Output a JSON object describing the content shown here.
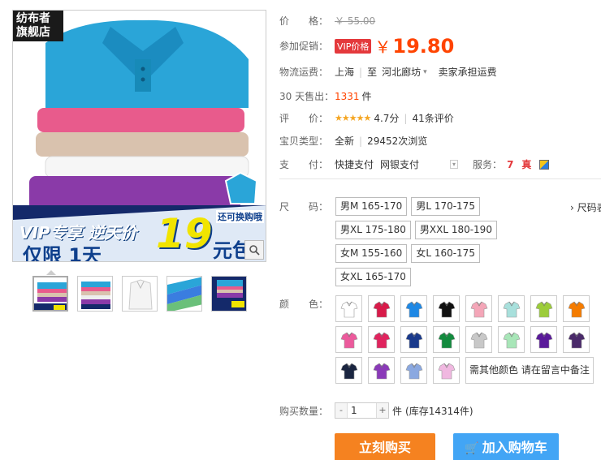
{
  "store_tag": "纺布者\n旗舰店",
  "banner": {
    "vip_line": "VIP专享 逆天价",
    "limit_line": "仅限 1天",
    "big_price": "19",
    "yuan_baoyou": "元包邮",
    "huangou": "还可换购哦"
  },
  "thumbnails": [
    "thumb-1",
    "thumb-2",
    "thumb-3",
    "thumb-4",
    "thumb-5"
  ],
  "price": {
    "label": "价　　格：",
    "original": "￥ 55.00",
    "promo_label": "参加促销：",
    "vip_badge": "VIP价格",
    "currency": "￥",
    "sale": "19.80"
  },
  "shipping": {
    "label": "物流运费：",
    "from": "上海",
    "to_prefix": "至",
    "to": "河北廊坊",
    "fee": "卖家承担运费"
  },
  "sales": {
    "label": "30 天售出：",
    "count": "1331",
    "unit": "件"
  },
  "rating": {
    "label": "评　　价：",
    "stars": "★★★★★",
    "score": "4.7分",
    "reviews": "41条评价"
  },
  "item_type": {
    "label": "宝贝类型：",
    "condition": "全新",
    "views": "29452次浏览"
  },
  "payment": {
    "label": "支　　付：",
    "method1": "快捷支付",
    "method2": "网银支付",
    "service_label": "服务："
  },
  "size": {
    "label": "尺　　码：",
    "options": [
      "男M 165-170",
      "男L 170-175",
      "男XL 175-180",
      "男XXL 180-190",
      "女M 155-160",
      "女L 160-175",
      "女XL 165-170"
    ],
    "chart_link": "› 尺码表"
  },
  "color": {
    "label": "颜　　色：",
    "swatches": [
      "#ffffff",
      "#d81b4a",
      "#1e88e5",
      "#111111",
      "#f4a6b8",
      "#a8e0dc",
      "#9ccc3a",
      "#f57c00",
      "#ec5a9c",
      "#e0245e",
      "#1a3a8c",
      "#138a3e",
      "#c8c8c8",
      "#a8e6b8",
      "#5a1a9a",
      "#4a2a6a",
      "#1a2540",
      "#8a3ab8",
      "#8aa8e0",
      "#f0b8e0"
    ],
    "other_text": "需其他颜色 请在留言中备注"
  },
  "quantity": {
    "label": "购买数量：",
    "minus": "-",
    "value": "1",
    "plus": "+",
    "unit": "件",
    "stock": "(库存14314件)"
  },
  "actions": {
    "buy_now": "立刻购买",
    "add_cart": "加入购物车"
  }
}
